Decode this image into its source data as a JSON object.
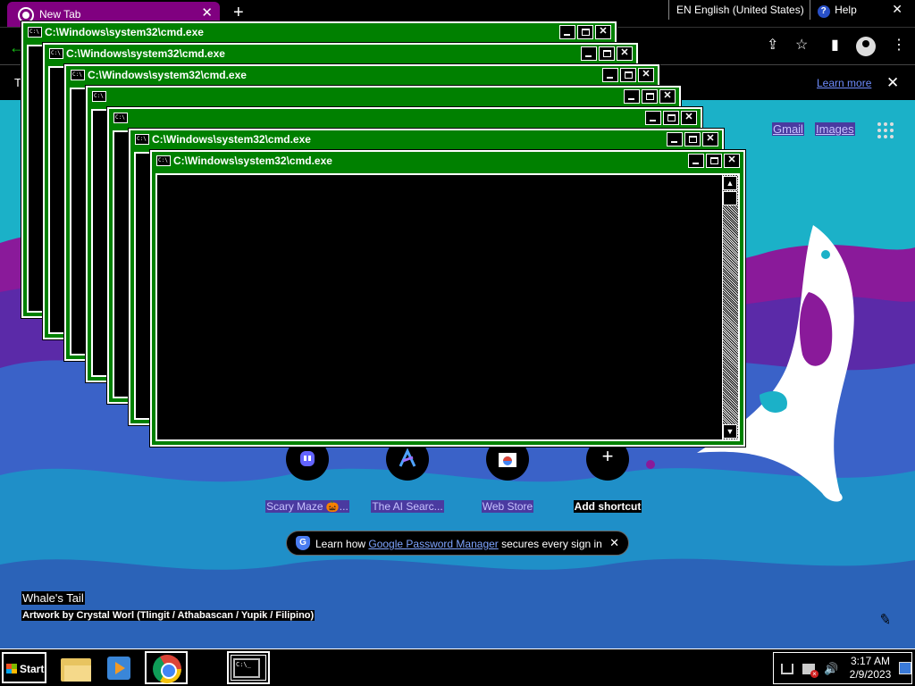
{
  "browser": {
    "tab_title": "New Tab",
    "tab_close": "✕",
    "new_tab": "+",
    "language": "EN English (United States)",
    "help": "Help",
    "help_mark": "?",
    "window_close": "✕",
    "infobar_text": "T",
    "infobar_link": "Learn more",
    "infobar_close": "✕",
    "back_arrow": "←",
    "share_icon": "⇪",
    "star_icon": "☆",
    "sidepanel_icon": "▮",
    "menu_icon": "⋮"
  },
  "ntp": {
    "links": {
      "gmail": "Gmail",
      "images": "Images"
    },
    "shortcuts": [
      {
        "label": "Scary Maze 🎃...",
        "icon": "mastodon-icon"
      },
      {
        "label": "The AI Searc...",
        "icon": "ai-search-icon"
      },
      {
        "label": "Web Store",
        "icon": "web-store-icon"
      },
      {
        "label": "Add shortcut",
        "icon": "plus-icon"
      }
    ],
    "add_glyph": "+",
    "password_promo": {
      "g_badge": "G",
      "prefix": "Learn how ",
      "link": "Google Password Manager",
      "suffix": " secures every sign in",
      "close": "✕"
    },
    "artwork": {
      "title": "Whale's Tail",
      "credit": "Artwork by Crystal Worl (Tlingit / Athabascan / Yupik / Filipino)"
    },
    "colors": {
      "water": "#1bb1c8",
      "sky_purple": "#8a1a9a",
      "tail": "#ffffff"
    }
  },
  "cmd_windows": [
    {
      "title": "C:\\Windows\\system32\\cmd.exe"
    },
    {
      "title": "C:\\Windows\\system32\\cmd.exe"
    },
    {
      "title": "C:\\Windows\\system32\\cmd.exe"
    },
    {
      "title": ""
    },
    {
      "title": ""
    },
    {
      "title": "C:\\Windows\\system32\\cmd.exe"
    },
    {
      "title": "C:\\Windows\\system32\\cmd.exe"
    }
  ],
  "cmd_ui": {
    "icon_text": "C:\\",
    "close": "✕",
    "up": "▲",
    "down": "▼"
  },
  "taskbar": {
    "start": "Start",
    "apps": [
      "folder-icon",
      "media-player-icon",
      "chrome-icon",
      "cmd-icon"
    ],
    "cmd_icon_text": "C:\\_",
    "time": "3:17 AM",
    "date": "2/9/2023",
    "volume_icon": "🔊"
  },
  "accent": "#008000"
}
